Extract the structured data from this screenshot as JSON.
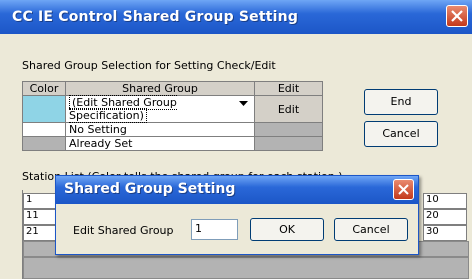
{
  "window": {
    "title": "CC IE Control Shared Group Setting"
  },
  "section_label": "Shared Group Selection for Setting Check/Edit",
  "group_table": {
    "headers": [
      "Color",
      "Shared Group",
      "Edit"
    ],
    "rows": [
      {
        "color": "#8fd4e6",
        "group": "(Edit Shared Group Specification)",
        "edit": "Edit"
      },
      {
        "color": "#ffffff",
        "group": "No Setting",
        "edit": ""
      },
      {
        "color": "#b3b3b3",
        "group": "Already Set",
        "edit": ""
      }
    ]
  },
  "buttons": {
    "end": "End",
    "cancel": "Cancel"
  },
  "station_list_label": "Station List (Color tells the shared group for each station.)",
  "station_rows": [
    {
      "start": "1",
      "end": "10"
    },
    {
      "start": "11",
      "end": "20"
    },
    {
      "start": "21",
      "end": "30"
    }
  ],
  "dialog": {
    "title": "Shared Group Setting",
    "field_label": "Edit Shared Group",
    "field_value": "1",
    "ok": "OK",
    "cancel": "Cancel"
  },
  "colors": {
    "accent": "#1c56c7",
    "cyan": "#8fd4e6",
    "gray": "#b3b3b3"
  }
}
